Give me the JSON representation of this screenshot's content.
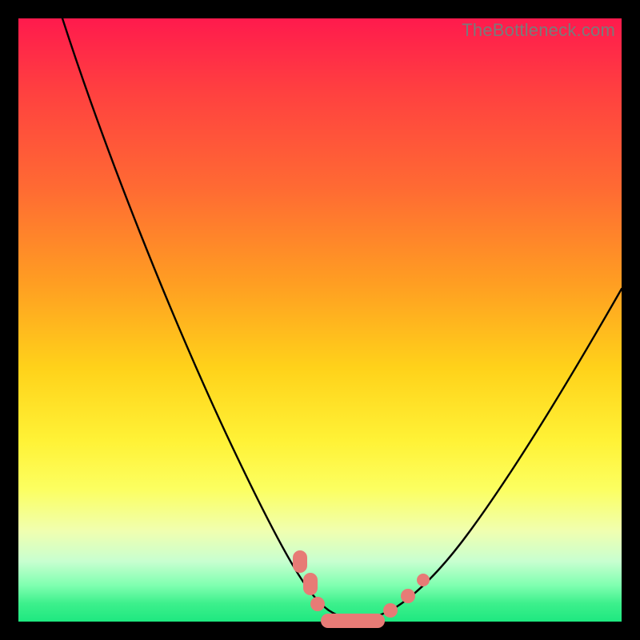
{
  "watermark": "TheBottleneck.com",
  "chart_data": {
    "type": "line",
    "title": "",
    "xlabel": "",
    "ylabel": "",
    "xlim": [
      0,
      100
    ],
    "ylim": [
      0,
      100
    ],
    "grid": false,
    "legend": false,
    "series": [
      {
        "name": "bottleneck-curve",
        "x": [
          0,
          5,
          10,
          15,
          20,
          25,
          30,
          35,
          40,
          43,
          46,
          49,
          51,
          53,
          55,
          58,
          62,
          68,
          75,
          82,
          90,
          100
        ],
        "y": [
          100,
          90,
          80,
          71,
          62,
          53,
          44,
          34,
          24,
          16,
          9,
          3,
          1,
          0,
          0,
          1,
          4,
          10,
          19,
          30,
          42,
          58
        ]
      }
    ],
    "highlight_points": {
      "name": "bottleneck-range-markers",
      "x": [
        43,
        46,
        49,
        53,
        55,
        58,
        62
      ],
      "y": [
        16,
        9,
        3,
        0,
        0,
        1,
        4
      ]
    }
  }
}
